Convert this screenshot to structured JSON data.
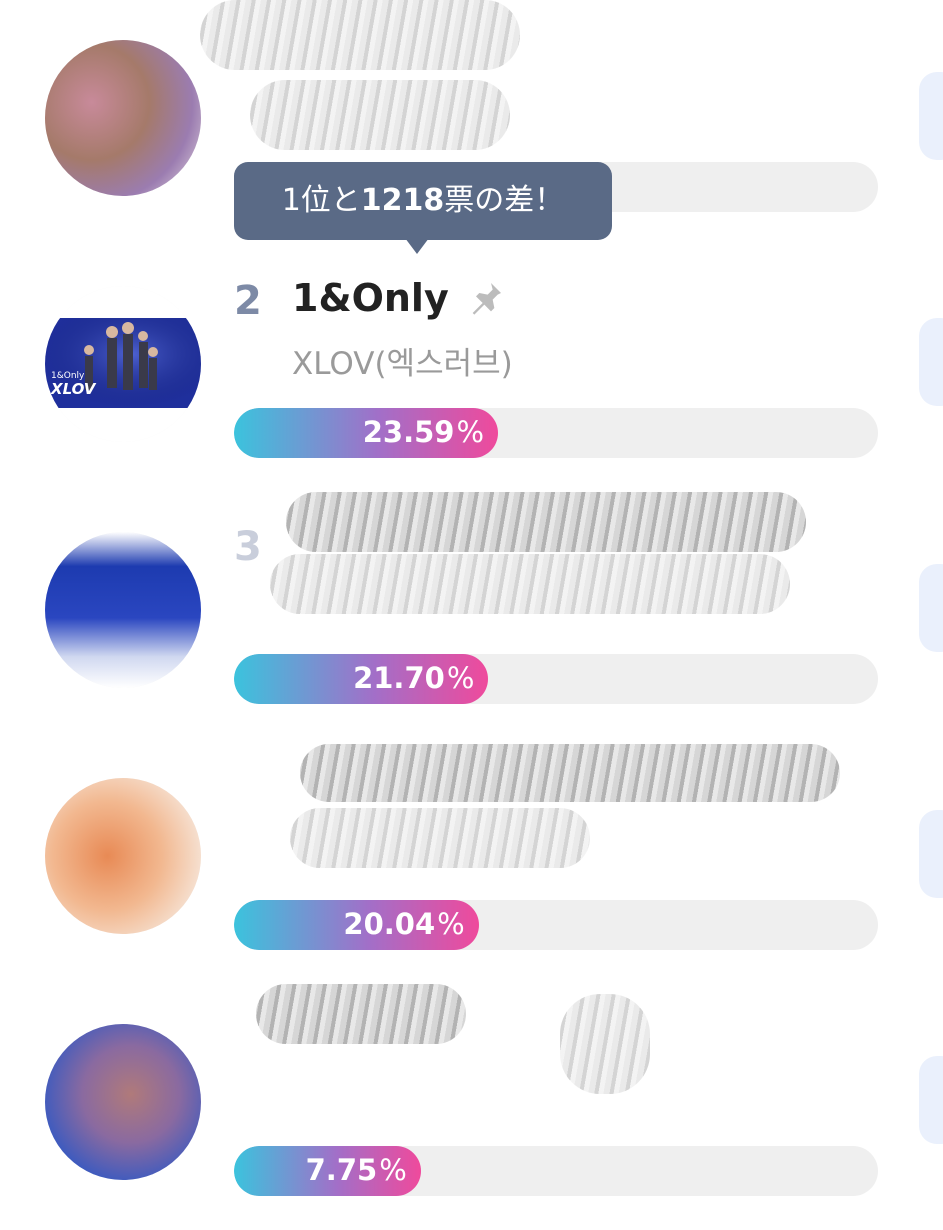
{
  "tooltip": {
    "prefix": "1位と",
    "amount": "1218",
    "suffix": "票の差！"
  },
  "items": [
    {
      "rank": "",
      "title": "",
      "artist": "",
      "percent": null,
      "percent_label": "",
      "fill": 0.0
    },
    {
      "rank": "2",
      "title": "1&Only",
      "artist": "XLOV(엑스러브)",
      "percent": 23.59,
      "percent_label": "23.59",
      "fill": 0.41,
      "thumb_text_1": "1&Only",
      "thumb_text_2": "XLOV"
    },
    {
      "rank": "3",
      "title": "",
      "artist": "",
      "percent": 21.7,
      "percent_label": "21.70",
      "fill": 0.395
    },
    {
      "rank": "",
      "title": "",
      "artist": "",
      "percent": 20.04,
      "percent_label": "20.04",
      "fill": 0.38
    },
    {
      "rank": "",
      "title": "",
      "artist": "",
      "percent": 7.75,
      "percent_label": "7.75",
      "fill": 0.29
    }
  ],
  "percent_unit": "%",
  "colors": {
    "bar_start": "#3bc3dd",
    "bar_mid": "#a26fc8",
    "bar_end": "#ef4a9c",
    "tooltip_bg": "#5a6a86",
    "rank_color": "#7d8aa6"
  },
  "icons": {
    "pin": "pushpin-icon"
  }
}
